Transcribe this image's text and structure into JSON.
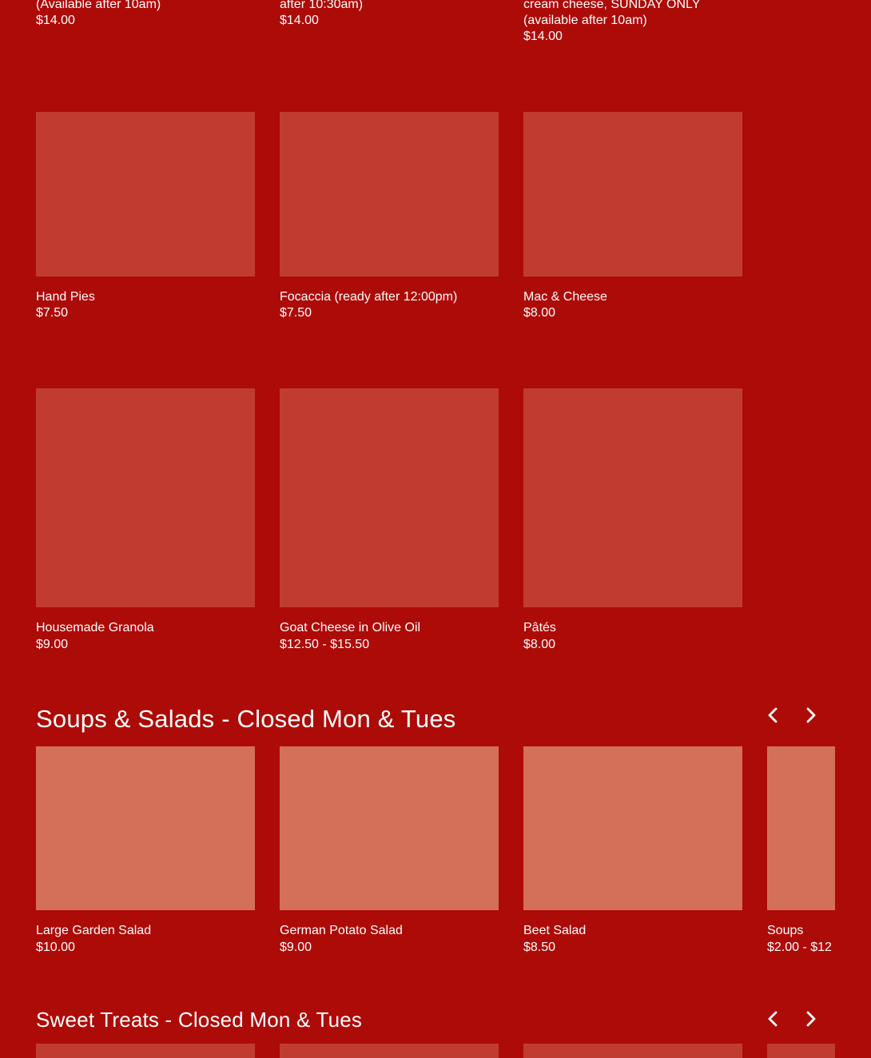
{
  "top_row": [
    {
      "name_line": "(Available after 10am)",
      "price": "$14.00"
    },
    {
      "name_line": "after 10:30am)",
      "price": "$14.00"
    },
    {
      "name_line_1": "cream cheese, SUNDAY ONLY",
      "name_line_2": "(available after 10am)",
      "price": "$14.00"
    }
  ],
  "row_2": [
    {
      "name": "Hand Pies",
      "price": "$7.50"
    },
    {
      "name": "Focaccia (ready after 12:00pm)",
      "price": "$7.50"
    },
    {
      "name": "Mac & Cheese",
      "price": "$8.00"
    }
  ],
  "row_3": [
    {
      "name": "Housemade Granola",
      "price": "$9.00"
    },
    {
      "name": "Goat Cheese in Olive Oil",
      "price": "$12.50 - $15.50"
    },
    {
      "name": "Pâtés",
      "price": "$8.00"
    }
  ],
  "soups_section": {
    "title": "Soups & Salads - Closed Mon & Tues",
    "items": [
      {
        "name": "Large Garden Salad",
        "price": "$10.00"
      },
      {
        "name": "German Potato Salad",
        "price": "$9.00"
      },
      {
        "name": "Beet Salad",
        "price": "$8.50"
      },
      {
        "name": "Soups",
        "price": "$2.00 - $12"
      }
    ]
  },
  "sweets_section": {
    "title": "Sweet Treats - Closed Mon & Tues"
  },
  "icons": {
    "prev": "chevron-left-icon",
    "next": "chevron-right-icon"
  },
  "colors": {
    "background": "#ad0b08",
    "tile": "#c13c30",
    "tile_light": "#d4705a",
    "text": "#ffffff"
  }
}
